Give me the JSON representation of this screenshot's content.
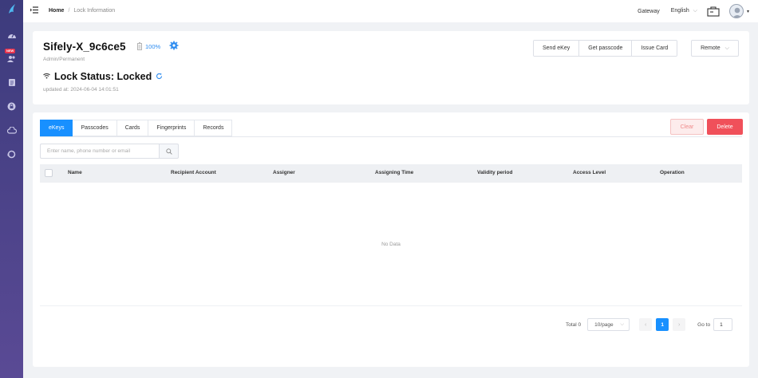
{
  "sidebar": {
    "new_badge": "NEW",
    "icons": [
      "logo-icon",
      "dashboard-icon",
      "users-icon",
      "records-icon",
      "lock-icon",
      "cloud-icon",
      "support-icon"
    ]
  },
  "topbar": {
    "breadcrumb": {
      "home": "Home",
      "separator": "/",
      "current": "Lock Information"
    },
    "gateway": "Gateway",
    "language": "English",
    "lang_caret": "⌵",
    "avatar_caret": "▾"
  },
  "lock": {
    "name": "Sifely-X_9c6ce5",
    "battery": "100%",
    "role": "Admin/Permanent",
    "status": "Lock Status: Locked",
    "updated": "updated at: 2024-06-04 14:01:51"
  },
  "actions": {
    "send_ekey": "Send eKey",
    "get_passcode": "Get passcode",
    "issue_card": "Issue Card",
    "remote": "Remote",
    "remote_caret": "⌵"
  },
  "tabs": [
    "eKeys",
    "Passcodes",
    "Cards",
    "Fingerprints",
    "Records"
  ],
  "buttons": {
    "clear": "Clear",
    "delete": "Delete"
  },
  "search": {
    "placeholder": "Enter name, phone number or email"
  },
  "table": {
    "columns": [
      "Name",
      "Recipient Account",
      "Assigner",
      "Assigning Time",
      "Validity period",
      "Access Level",
      "Operation"
    ],
    "empty": "No Data"
  },
  "pagination": {
    "total": "Total 0",
    "page_size": "10/page",
    "size_caret": "⌵",
    "prev": "‹",
    "current": "1",
    "next": "›",
    "goto_label": "Go to",
    "goto_value": "1"
  },
  "colors": {
    "primary": "#1890ff",
    "danger": "#f0505a",
    "sidebar": "#3c3b7c"
  }
}
